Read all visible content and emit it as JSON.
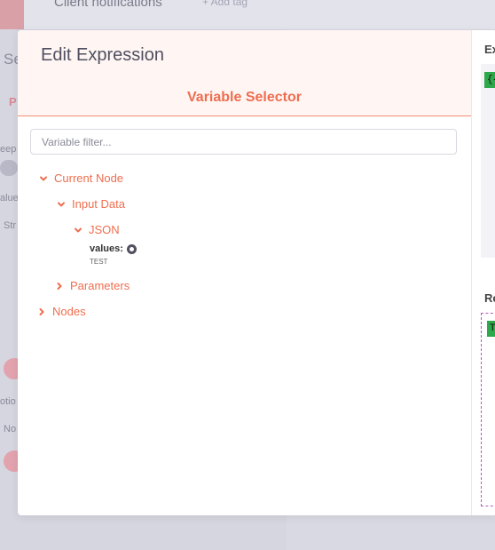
{
  "background": {
    "title": "Client notifications",
    "add_tag": "+ Add tag",
    "fragments": [
      "Se",
      "P",
      "eep",
      "alue",
      "Str",
      "otio",
      "No"
    ]
  },
  "modal": {
    "title": "Edit Expression",
    "selector_title": "Variable Selector",
    "filter_placeholder": "Variable filter...",
    "tree": {
      "current_node": "Current Node",
      "input_data": "Input Data",
      "json": "JSON",
      "value_key": "values:",
      "value_sample": "TEST",
      "parameters": "Parameters",
      "nodes": "Nodes"
    },
    "right_panel": {
      "expression_label": "Ex",
      "expression_chip": "{{",
      "result_label": "Re",
      "result_chip": "T"
    }
  },
  "colors": {
    "accent": "#ee6e4f",
    "header_bg": "#fff5f3",
    "chip_green": "#2da84a",
    "result_border": "#b45cb4"
  },
  "icons": {
    "expanded": "chevron-down-icon",
    "collapsed": "chevron-right-icon",
    "value_type": "circle-dot-icon"
  }
}
